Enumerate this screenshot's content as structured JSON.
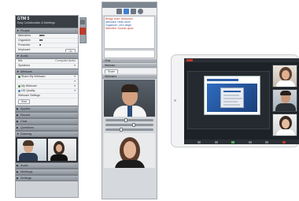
{
  "panel1": {
    "title": "GTM 5",
    "subtitle": "Easy Collaboration & Meetings",
    "section_people": "People",
    "people_values": [
      "",
      ""
    ],
    "rows": [
      {
        "label": "Attendees",
        "value": ""
      },
      {
        "label": "Organizer",
        "value": ""
      },
      {
        "label": "Presenter",
        "value": ""
      },
      {
        "label": "Keyboard",
        "value": ""
      }
    ],
    "section_audio": "Audio",
    "audio_rows": [
      {
        "label": "Mic",
        "value": "Computer Audio"
      },
      {
        "label": "Speakers",
        "value": ""
      }
    ],
    "section_webcam": "Webcam",
    "webcam_rows": [
      {
        "label": "Share My Webcam"
      },
      {
        "label": ""
      },
      {
        "label": "My Webcam"
      },
      {
        "label": "HD Quality"
      }
    ],
    "webcam_footer": "Webcam Settings",
    "action_button": "Start",
    "collapsed_sections": [
      "Applies",
      "Recent",
      "Chat",
      "Questions",
      "Drawing"
    ],
    "footer_sections": [
      "Audio",
      "Meetings",
      "Settings"
    ]
  },
  "panel2": {
    "chat_lines": [
      {
        "text": "Bridge User: Welcome!",
        "color": "red"
      },
      {
        "text": "Attendee: Hello there",
        "color": "blue"
      },
      {
        "text": "Organizer: Let's begin",
        "color": "blue"
      },
      {
        "text": "Attendee: Sounds good",
        "color": "red"
      }
    ],
    "bars": [
      "Chat",
      "Webcam",
      "Webcams"
    ],
    "share_label": "Share"
  },
  "tablet": {
    "slide_title": ""
  },
  "colors": {
    "accent_red": "#c0392b",
    "accent_blue": "#3d7fd6",
    "panel_header": "#3a3f46"
  }
}
